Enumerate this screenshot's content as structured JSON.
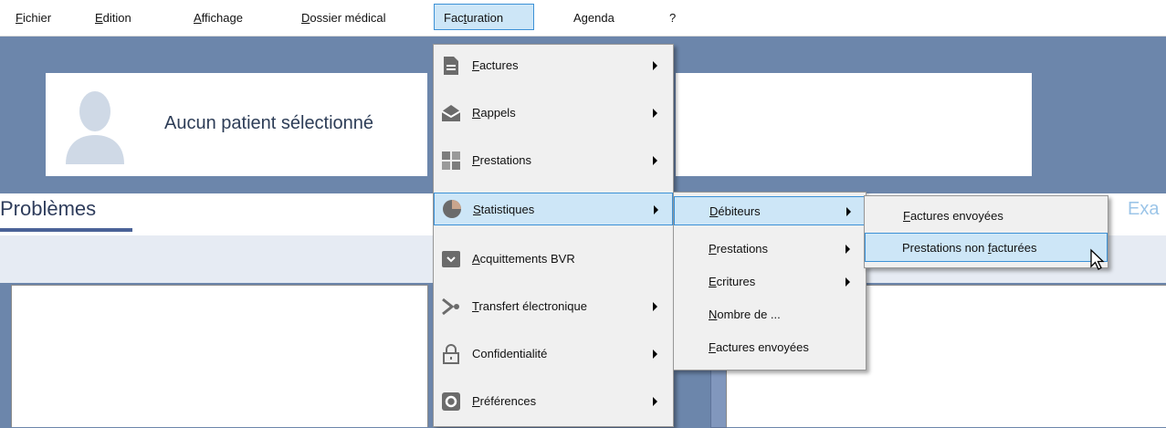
{
  "menubar": {
    "fichier": {
      "pre": "",
      "acc": "F",
      "post": "ichier"
    },
    "edition": {
      "pre": "",
      "acc": "E",
      "post": "dition"
    },
    "affichage": {
      "pre": "",
      "acc": "A",
      "post": "ffichage"
    },
    "dossier": {
      "pre": "",
      "acc": "D",
      "post": "ossier médical"
    },
    "facturation": {
      "pre": "Fac",
      "acc": "t",
      "post": "uration"
    },
    "agenda": {
      "pre": "A",
      "acc": "g",
      "post": "enda"
    },
    "help": "?"
  },
  "patient": {
    "none_text": "Aucun patient sélectionné"
  },
  "tabs": {
    "problemes": "Problèmes",
    "right_partial": "Exa"
  },
  "menu_facturation": {
    "factures": {
      "acc": "F",
      "post": "actures"
    },
    "rappels": {
      "acc": "R",
      "post": "appels"
    },
    "prestations": {
      "acc": "P",
      "post": "restations"
    },
    "statistiques": {
      "acc": "S",
      "post": "tatistiques"
    },
    "acquittements": {
      "acc": "A",
      "post": "cquittements BVR"
    },
    "transfert": {
      "acc": "T",
      "post": "ransfert électronique"
    },
    "confidentialite": {
      "pre": "Confidentialité"
    },
    "preferences": {
      "acc": "P",
      "post": "références"
    }
  },
  "menu_statistiques": {
    "debiteurs": {
      "acc": "D",
      "post": "ébiteurs"
    },
    "prestations": {
      "acc": "P",
      "post": "restations"
    },
    "ecritures": {
      "acc": "E",
      "post": "critures"
    },
    "nombre": {
      "acc": "N",
      "post": "ombre de ..."
    },
    "factures_envoyees": {
      "acc": "F",
      "post": "actures envoyées"
    }
  },
  "menu_debiteurs": {
    "factures_envoyees": {
      "acc": "F",
      "post": "actures envoyées"
    },
    "prestations_non_facturees": {
      "pre": "Prestations non ",
      "acc": "f",
      "post": "acturées"
    }
  }
}
